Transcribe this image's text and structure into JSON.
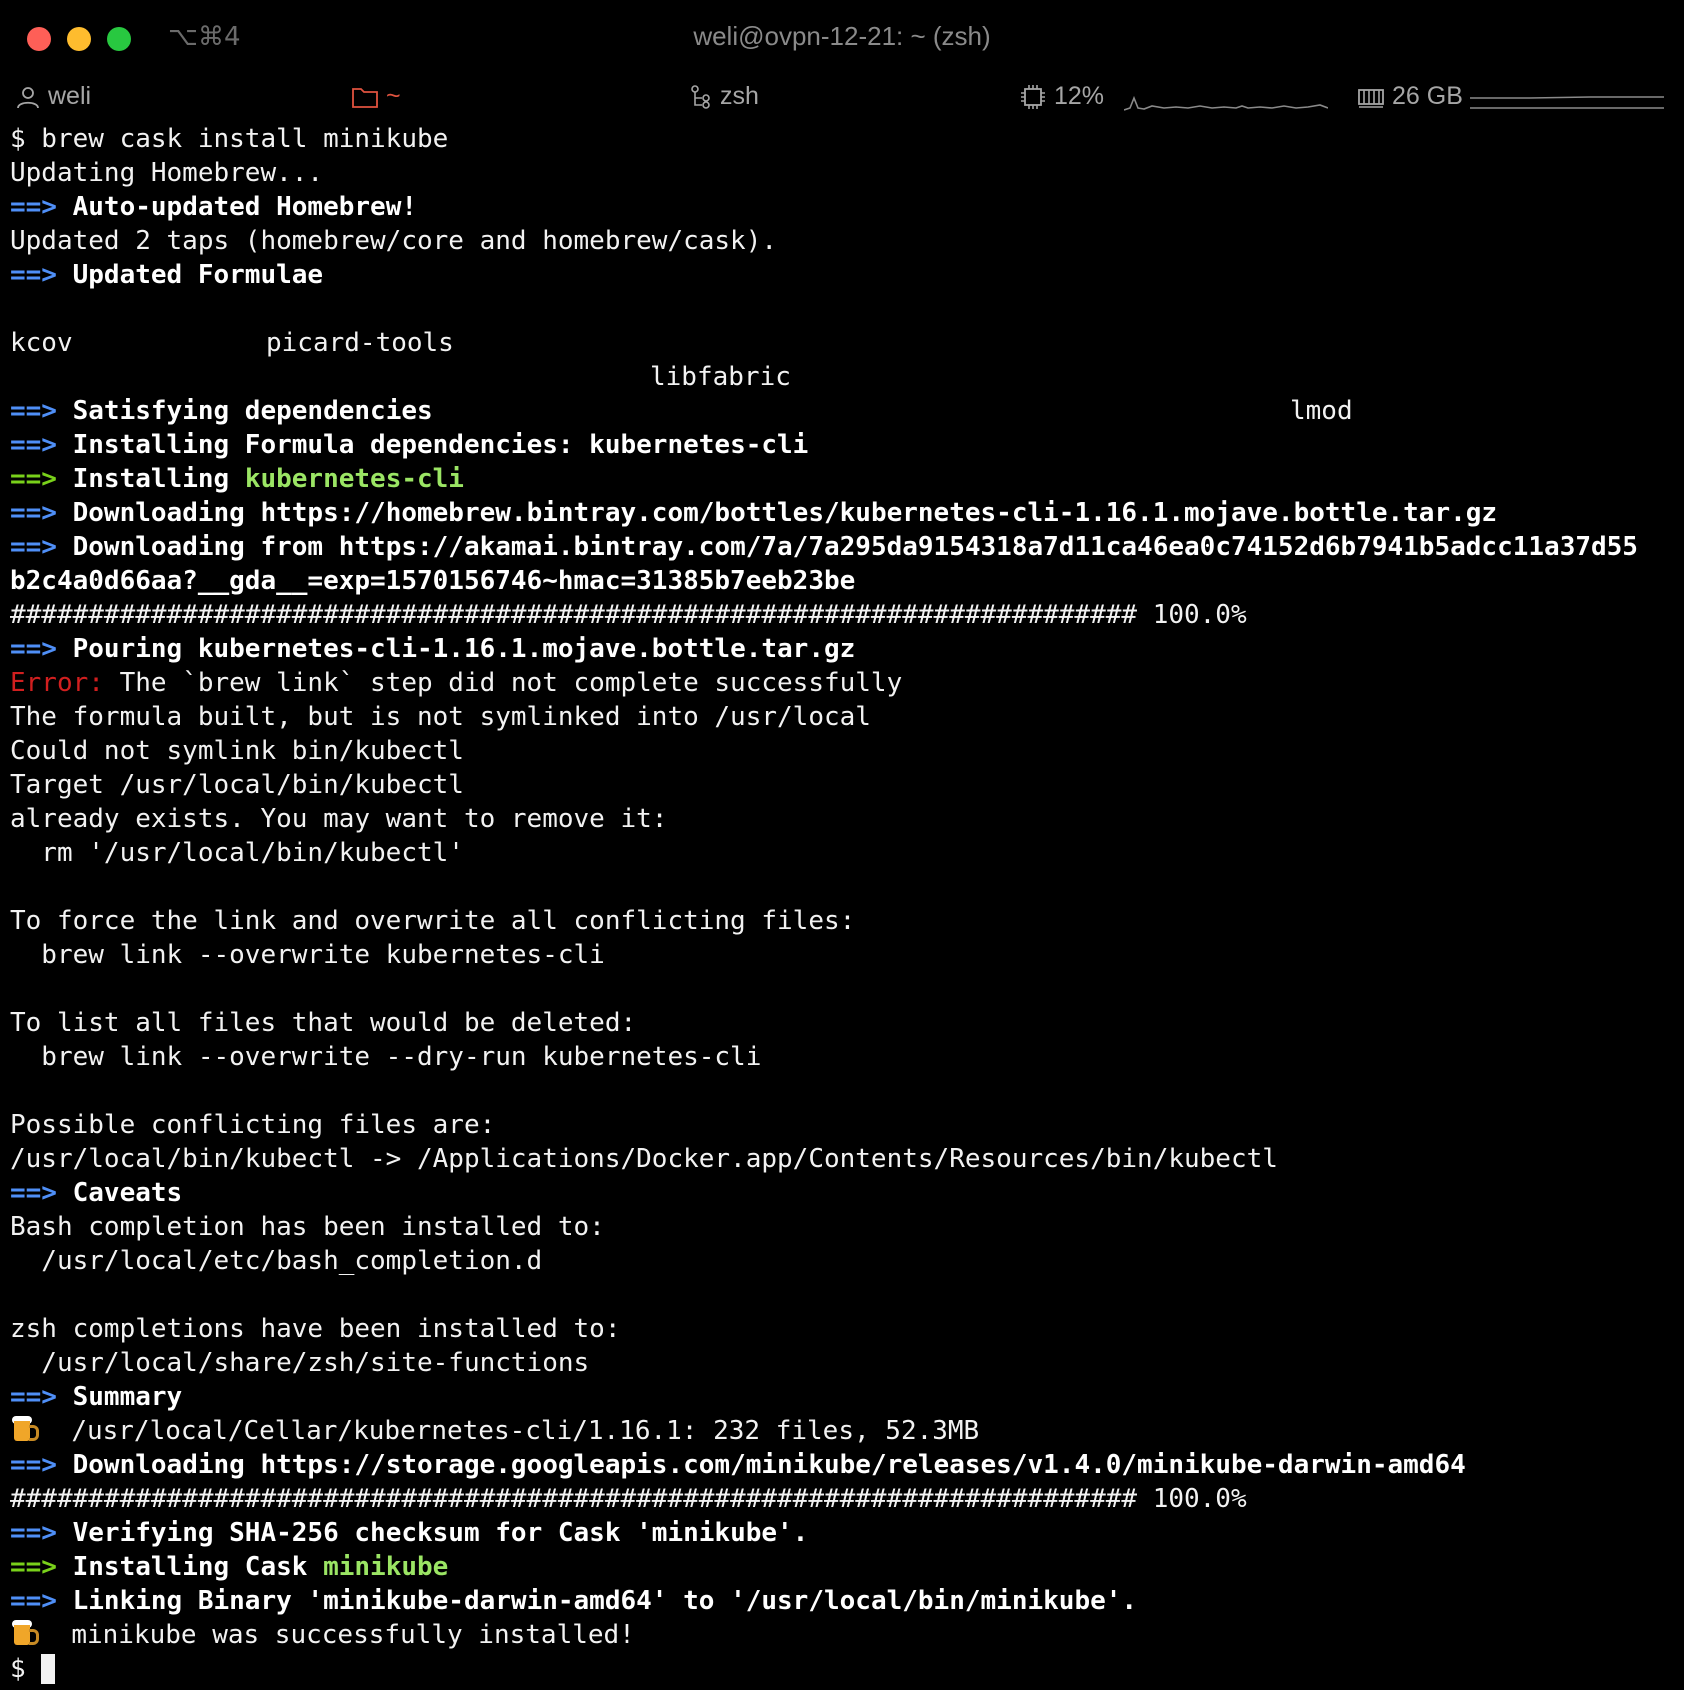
{
  "window": {
    "shortcut": "⌥⌘4",
    "title": "weli@ovpn-12-21: ~ (zsh)"
  },
  "statusbar": {
    "user": "weli",
    "dir": "~",
    "shell": "zsh",
    "cpu": "12%",
    "mem": "26 GB"
  },
  "colors": {
    "arrow_blue": "#4f8ff7",
    "arrow_green": "#79d11a",
    "highlight_green": "#9be564",
    "error_red": "#d11f1f"
  },
  "terminal": {
    "l1": "$ brew cask install minikube",
    "l2": "Updating Homebrew...",
    "arrow": "==>",
    "l3": "Auto-updated Homebrew!",
    "l4": "Updated 2 taps (homebrew/core and homebrew/cask).",
    "l5": "Updated Formulae",
    "formula_1": "kcov",
    "formula_2": "libfabric",
    "formula_3": "lmod",
    "formula_4": "picard-tools",
    "l8": "Satisfying dependencies",
    "l9": "Installing Formula dependencies: kubernetes-cli",
    "l10_prefix": "Installing ",
    "l10_pkg": "kubernetes-cli",
    "l11": "Downloading https://homebrew.bintray.com/bottles/kubernetes-cli-1.16.1.mojave.bottle.tar.gz",
    "l12": "Downloading from https://akamai.bintray.com/7a/7a295da9154318a7d11ca46ea0c74152d6b7941b5adcc11a37d55",
    "l13": "b2c4a0d66aa?__gda__=exp=1570156746~hmac=31385b7eeb23be",
    "l14": "######################################################################## 100.0%",
    "l15": "Pouring kubernetes-cli-1.16.1.mojave.bottle.tar.gz",
    "l16_err": "Error:",
    "l16": " The `brew link` step did not complete successfully",
    "l17": "The formula built, but is not symlinked into /usr/local",
    "l18": "Could not symlink bin/kubectl",
    "l19": "Target /usr/local/bin/kubectl",
    "l20": "already exists. You may want to remove it:",
    "l21": "  rm '/usr/local/bin/kubectl'",
    "l23": "To force the link and overwrite all conflicting files:",
    "l24": "  brew link --overwrite kubernetes-cli",
    "l26": "To list all files that would be deleted:",
    "l27": "  brew link --overwrite --dry-run kubernetes-cli",
    "l29": "Possible conflicting files are:",
    "l30": "/usr/local/bin/kubectl -> /Applications/Docker.app/Contents/Resources/bin/kubectl",
    "l31": "Caveats",
    "l32": "Bash completion has been installed to:",
    "l33": "  /usr/local/etc/bash_completion.d",
    "l35": "zsh completions have been installed to:",
    "l36": "  /usr/local/share/zsh/site-functions",
    "l37": "Summary",
    "l38": "/usr/local/Cellar/kubernetes-cli/1.16.1: 232 files, 52.3MB",
    "l39": "Downloading https://storage.googleapis.com/minikube/releases/v1.4.0/minikube-darwin-amd64",
    "l40": "######################################################################## 100.0%",
    "l41": "Verifying SHA-256 checksum for Cask 'minikube'.",
    "l42_prefix": "Installing Cask ",
    "l42_pkg": "minikube",
    "l43": "Linking Binary 'minikube-darwin-amd64' to '/usr/local/bin/minikube'.",
    "l44": "minikube was successfully installed!",
    "prompt": "$ "
  }
}
